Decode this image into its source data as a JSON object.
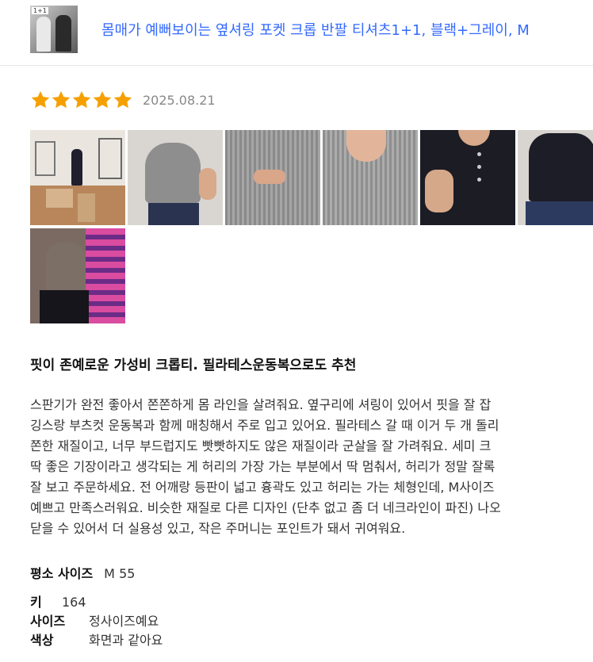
{
  "product": {
    "title": "몸매가 예뻐보이는 옆셔링 포켓 크롭 반팔 티셔츠1+1, 블랙+그레이, M",
    "thumb_tag": "1+1"
  },
  "review": {
    "rating": 5,
    "date": "2025.08.21",
    "headline": "핏이 존예로운 가성비 크롭티. 필라테스운동복으로도 추천",
    "body_lines": [
      "스판기가 완전 좋아서 쫀쫀하게 몸 라인을 살려줘요. 옆구리에 셔링이 있어서 핏을 잘 잡",
      "깅스랑 부츠컷 운동복과 함께 매칭해서 주로 입고 있어요. 필라테스 갈 때 이거 두 개 돌리",
      "쫀한 재질이고, 너무 부드럽지도 빳빳하지도 않은 재질이라 군살을 잘 가려줘요. 세미 크",
      "딱 좋은 기장이라고 생각되는 게 허리의 가장 가는 부분에서 딱 멈춰서, 허리가 정말 잘록",
      "잘 보고 주문하세요. 전 어깨랑 등판이 넓고 흉곽도 있고 허리는 가는 체형인데, M사이즈",
      "예쁘고 만족스러워요. 비슷한 재질로 다른 디자인 (단추 없고 좀 더 네크라인이 파진) 나오",
      "닫을 수 있어서 더 실용성 있고, 작은 주머니는 포인트가 돼서 귀여워요."
    ],
    "usual_size_label": "평소 사이즈",
    "usual_size_value": "M 55",
    "attributes": [
      {
        "key": "키",
        "value": "164"
      },
      {
        "key": "사이즈",
        "value": "정사이즈예요"
      },
      {
        "key": "색상",
        "value": "화면과 같아요"
      }
    ]
  },
  "colors": {
    "link": "#346aff",
    "star": "#f5a000",
    "date": "#888888"
  }
}
